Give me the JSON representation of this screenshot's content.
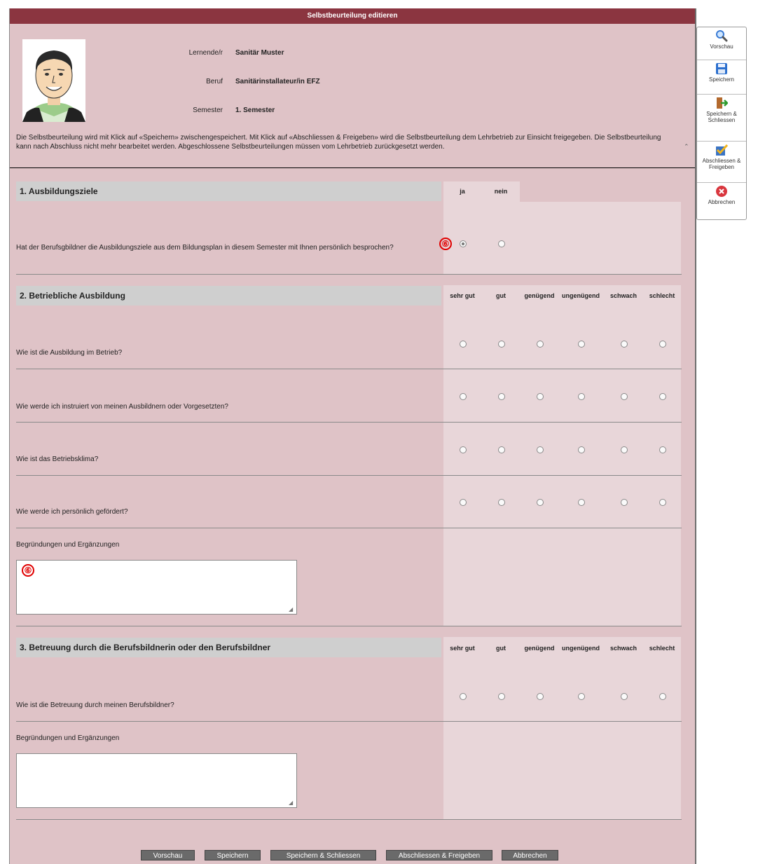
{
  "window": {
    "title": "Selbstbeurteilung editieren"
  },
  "person": {
    "labels": {
      "learner": "Lernende/r",
      "profession": "Beruf",
      "semester": "Semester"
    },
    "values": {
      "learner": "Sanitär Muster",
      "profession": "Sanitärinstallateur/in EFZ",
      "semester": "1. Semester"
    }
  },
  "notice": "Die Selbstbeurteilung wird mit Klick auf «Speichern» zwischengespeichert. Mit Klick auf «Abschliessen & Freigeben» wird die Selbstbeurteilung dem Lehrbetrieb zur Einsicht freigegeben. Die Selbstbeurteilung kann nach Abschluss nicht mehr bearbeitet werden. Abgeschlossene Selbstbeurteilungen müssen vom Lehrbetrieb zurückgesetzt werden.",
  "scroll_up_glyph": "⌃",
  "sections": [
    {
      "title": "1.  Ausbildungsziele",
      "columns": [
        "ja",
        "nein"
      ],
      "questions": [
        {
          "text": "Hat der Berufsgbildner die Ausbildungsziele aus dem Bildungsplan in diesem Semester mit Ihnen persönlich besprochen?",
          "selected": "ja"
        }
      ]
    },
    {
      "title": "2.  Betriebliche Ausbildung",
      "columns": [
        "sehr gut",
        "gut",
        "genügend",
        "ungenügend",
        "schwach",
        "schlecht"
      ],
      "questions": [
        {
          "text": "Wie ist die Ausbildung im Betrieb?"
        },
        {
          "text": "Wie werde ich instruiert von meinen Ausbildnern oder Vorgesetzten?"
        },
        {
          "text": "Wie ist das Betriebsklima?"
        },
        {
          "text": "Wie werde ich persönlich gefördert?"
        }
      ],
      "comment_label": "Begründungen und Ergänzungen",
      "comment_value": ""
    },
    {
      "title": "3.  Betreuung durch die Berufsbildnerin oder den Berufsbildner",
      "columns": [
        "sehr gut",
        "gut",
        "genügend",
        "ungenügend",
        "schwach",
        "schlecht"
      ],
      "questions": [
        {
          "text": "Wie ist die Betreuung durch meinen Berufsbildner?"
        }
      ],
      "comment_label": "Begründungen und Ergänzungen",
      "comment_value": ""
    }
  ],
  "markers": [
    "⑥",
    "⑥"
  ],
  "buttons": {
    "preview": "Vorschau",
    "save": "Speichern",
    "save_close": "Speichern & Schliessen",
    "finish_release": "Abschliessen & Freigeben",
    "cancel": "Abbrechen"
  },
  "toolbar": [
    {
      "label": "Vorschau",
      "icon": "magnifier-icon"
    },
    {
      "label": "Speichern",
      "icon": "floppy-disk-icon"
    },
    {
      "label": "Speichern & Schliessen",
      "icon": "exit-door-icon"
    },
    {
      "label": "Abschliessen & Freigeben",
      "icon": "checkmark-document-icon"
    },
    {
      "label": "Abbrechen",
      "icon": "cancel-circle-icon"
    }
  ],
  "colors": {
    "title_bar": "#8b3540",
    "panel": "#dfc3c7",
    "answer_column": "#e8d6d9",
    "section_header": "#cfcfcf",
    "button": "#6a6a6a",
    "marker": "#e00000"
  }
}
